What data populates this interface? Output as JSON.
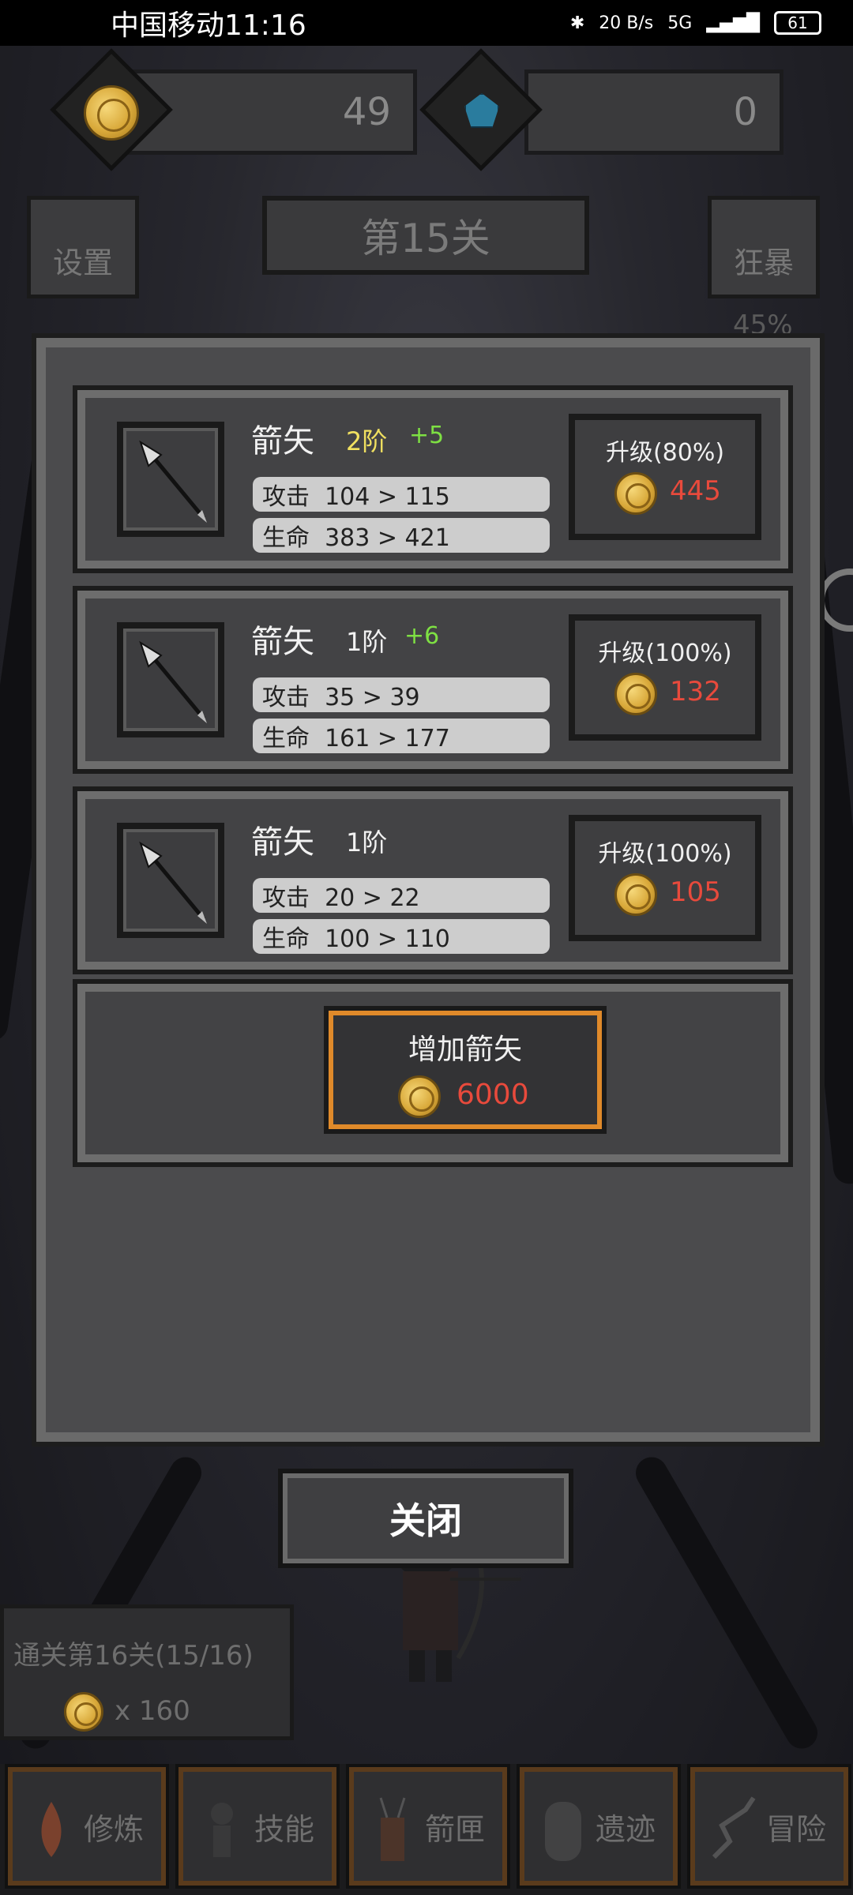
{
  "status_bar": {
    "carrier_time": "中国移动11:16",
    "net_speed": "20 B/s",
    "network": "5G",
    "battery": "61"
  },
  "currency": {
    "coins": "49",
    "gems": "0"
  },
  "top": {
    "settings_label": "设置",
    "level_title": "第15关",
    "rage_label": "狂暴",
    "rage_percent": "45%"
  },
  "weapons": [
    {
      "name": "箭矢",
      "tier": "2阶",
      "bonus": "+5",
      "attack": "攻击  104 > 115",
      "hp": "生命  383 > 421",
      "upgrade_label": "升级(80%)",
      "price": "445"
    },
    {
      "name": "箭矢",
      "tier": "1阶",
      "bonus": "+6",
      "attack": "攻击  35 > 39",
      "hp": "生命  161 > 177",
      "upgrade_label": "升级(100%)",
      "price": "132"
    },
    {
      "name": "箭矢",
      "tier": "1阶",
      "bonus": "",
      "attack": "攻击  20 > 22",
      "hp": "生命  100 > 110",
      "upgrade_label": "升级(100%)",
      "price": "105"
    }
  ],
  "add_arrow": {
    "label": "增加箭矢",
    "price": "6000"
  },
  "close_label": "关闭",
  "quest": {
    "title": "通关第16关(15/16)",
    "reward": "x 160"
  },
  "nav": [
    {
      "label": "修炼",
      "icon": "campfire-icon"
    },
    {
      "label": "技能",
      "icon": "archer-icon"
    },
    {
      "label": "箭匣",
      "icon": "quiver-icon"
    },
    {
      "label": "遗迹",
      "icon": "relic-icon"
    },
    {
      "label": "冒险",
      "icon": "path-icon"
    }
  ],
  "colors": {
    "price_red": "#e84a3c",
    "bonus_green": "#7ee043",
    "tier_gold": "#f0e060",
    "add_button_border": "#e08a2a"
  }
}
